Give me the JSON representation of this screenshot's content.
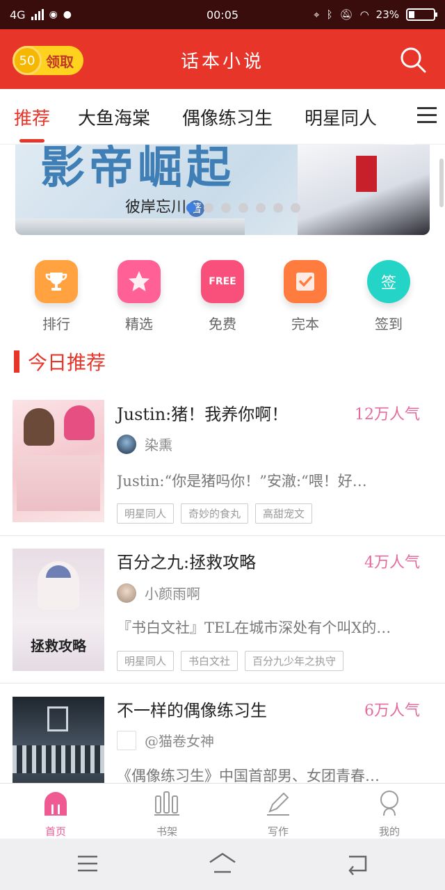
{
  "status_bar": {
    "network": "4G",
    "time": "00:05",
    "battery": "23%",
    "battery_level": 0.23
  },
  "header": {
    "coin_count": "50",
    "claim_label": "领取",
    "app_title": "话本小说"
  },
  "tabs": [
    {
      "label": "推荐",
      "active": true
    },
    {
      "label": "大鱼海棠"
    },
    {
      "label": "偶像练习生"
    },
    {
      "label": "明星同人"
    }
  ],
  "banner": {
    "title_fragment": "影帝崛起",
    "author": "彼岸忘川",
    "author_badge": "著",
    "dot_count": 7,
    "active_dot": 0
  },
  "quick_links": [
    {
      "label": "排行",
      "icon": "trophy-icon",
      "color": "#ff9b3a"
    },
    {
      "label": "精选",
      "icon": "star-icon",
      "color": "#ff5f8f"
    },
    {
      "label": "免费",
      "icon": "free-tag-icon",
      "color": "#f8507a",
      "icon_text": "FREE"
    },
    {
      "label": "完本",
      "icon": "check-document-icon",
      "color": "#ff7a3c"
    },
    {
      "label": "签到",
      "icon": "sign-in-icon",
      "color": "#25d3c5",
      "icon_text": "签"
    }
  ],
  "section": {
    "title": "今日推荐"
  },
  "books": [
    {
      "title": "Justin:猪！我养你啊！",
      "popularity": "12万人气",
      "author": "染熏",
      "description": "Justin:“你是猪吗你！”安澈:“喂！好…",
      "tags": [
        "明星同人",
        "奇妙的食丸",
        "高甜宠文"
      ]
    },
    {
      "title": "百分之九:拯救攻略",
      "popularity": "4万人气",
      "author": "小颜雨啊",
      "description": "『书白文社』TEL在城市深处有个叫X的…",
      "tags": [
        "明星同人",
        "书白文社",
        "百分九少年之执守"
      ],
      "cover_text": "拯救攻略"
    },
    {
      "title": "不一样的偶像练习生",
      "popularity": "6万人气",
      "author": "@猫卷女神",
      "description": "《偶像练习生》中国首部男、女团青春…",
      "tags": []
    }
  ],
  "bottom_nav": [
    {
      "label": "首页",
      "icon": "home-icon",
      "active": true
    },
    {
      "label": "书架",
      "icon": "bookshelf-icon"
    },
    {
      "label": "写作",
      "icon": "pencil-icon"
    },
    {
      "label": "我的",
      "icon": "profile-icon"
    }
  ],
  "system_nav": [
    "menu-icon",
    "home-key-icon",
    "back-icon"
  ]
}
